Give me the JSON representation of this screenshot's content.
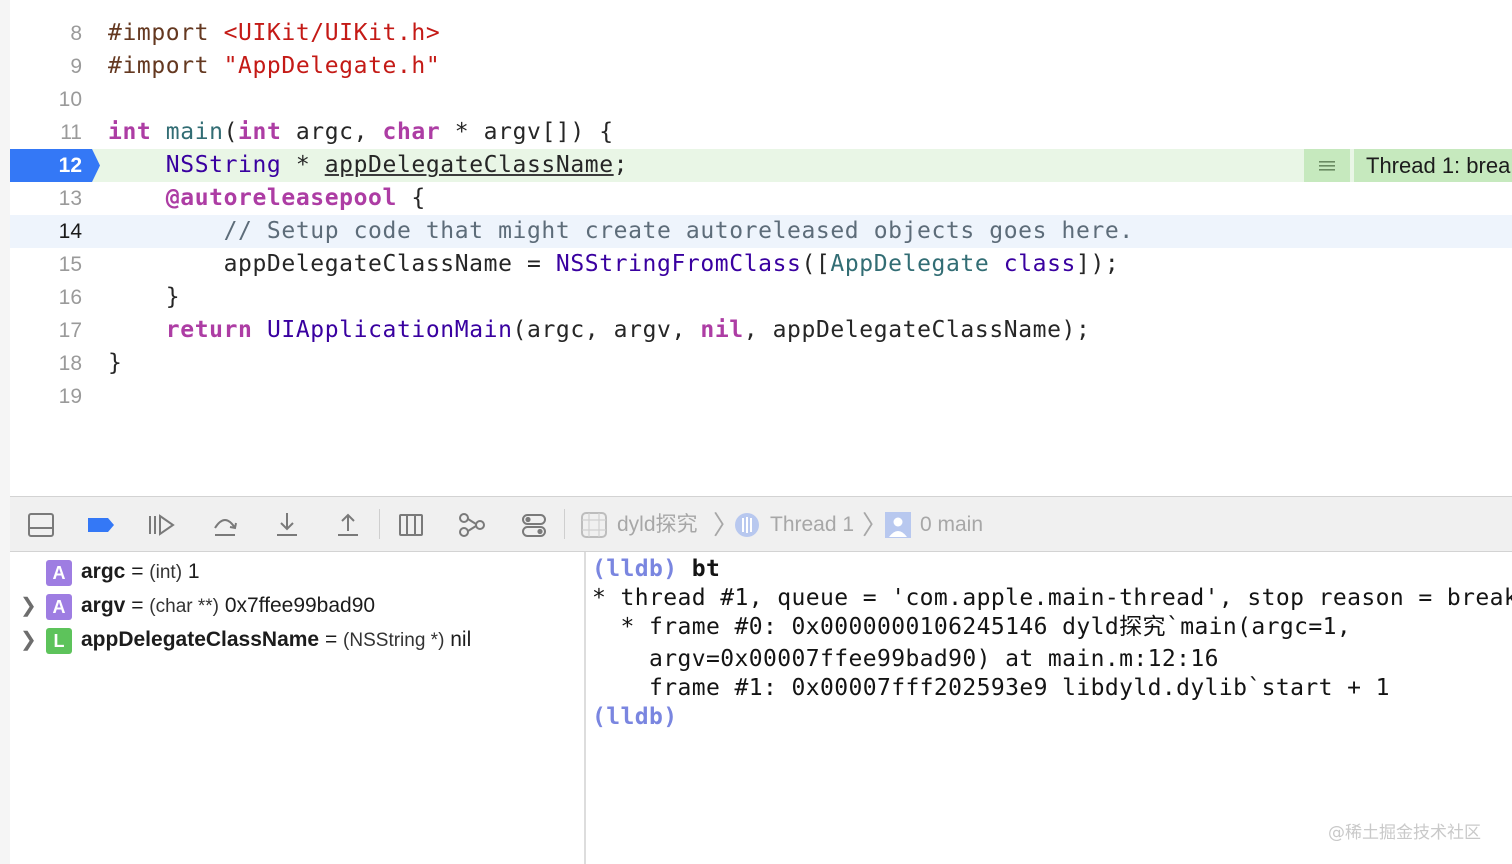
{
  "editor": {
    "lines": [
      {
        "num": "8"
      },
      {
        "num": "9"
      },
      {
        "num": "10"
      },
      {
        "num": "11"
      },
      {
        "num": "12"
      },
      {
        "num": "13"
      },
      {
        "num": "14"
      },
      {
        "num": "15"
      },
      {
        "num": "16"
      },
      {
        "num": "17"
      },
      {
        "num": "18"
      },
      {
        "num": "19"
      }
    ],
    "tokens": {
      "l8_kw": "#import",
      "l8_str": "<UIKit/UIKit.h>",
      "l9_kw": "#import",
      "l9_str": "\"AppDelegate.h\"",
      "l11_int": "int",
      "l11_main": "main",
      "l11_paren": "(",
      "l11_int2": "int",
      "l11_argc": " argc, ",
      "l11_char": "char",
      "l11_rest": " * argv[]) {",
      "l12_type": "NSString",
      "l12_star": " * ",
      "l12_var": "appDelegateClassName",
      "l12_semi": ";",
      "l13_kw": "@autoreleasepool",
      "l13_brace": " {",
      "l14_comment": "// Setup code that might create autoreleased objects goes here.",
      "l15_var": "appDelegateClassName = ",
      "l15_fn": "NSStringFromClass",
      "l15_open": "([",
      "l15_cls": "AppDelegate",
      "l15_sp": " ",
      "l15_class": "class",
      "l15_close": "]);",
      "l16_brace": "}",
      "l17_return": "return",
      "l17_sp": " ",
      "l17_fn": "UIApplicationMain",
      "l17_args": "(argc, argv, ",
      "l17_nil": "nil",
      "l17_rest": ", appDelegateClassName);",
      "l18_brace": "}"
    },
    "thread_indicator": {
      "label": "Thread 1: brea"
    }
  },
  "debugbar": {
    "breadcrumb": [
      "dyld探究",
      "Thread 1",
      "0 main"
    ]
  },
  "variables": [
    {
      "kind": "A",
      "name": "argc",
      "eq": " = ",
      "type": "(int)",
      "value": " 1"
    },
    {
      "kind": "A",
      "name": "argv",
      "eq": " = ",
      "type": "(char **)",
      "value": " 0x7ffee99bad90"
    },
    {
      "kind": "L",
      "name": "appDelegateClassName",
      "eq": " = ",
      "type": "(NSString *)",
      "value": " nil"
    }
  ],
  "console": {
    "prompt": "(lldb)",
    "command": " bt",
    "output": [
      "* thread #1, queue = 'com.apple.main-thread', stop reason = break",
      "  * frame #0: 0x0000000106245146 dyld探究`main(argc=1,",
      "    argv=0x00007ffee99bad90) at main.m:12:16",
      "    frame #1: 0x00007fff202593e9 libdyld.dylib`start + 1"
    ],
    "prompt2": "(lldb)"
  },
  "watermark": "@稀土掘金技术社区"
}
